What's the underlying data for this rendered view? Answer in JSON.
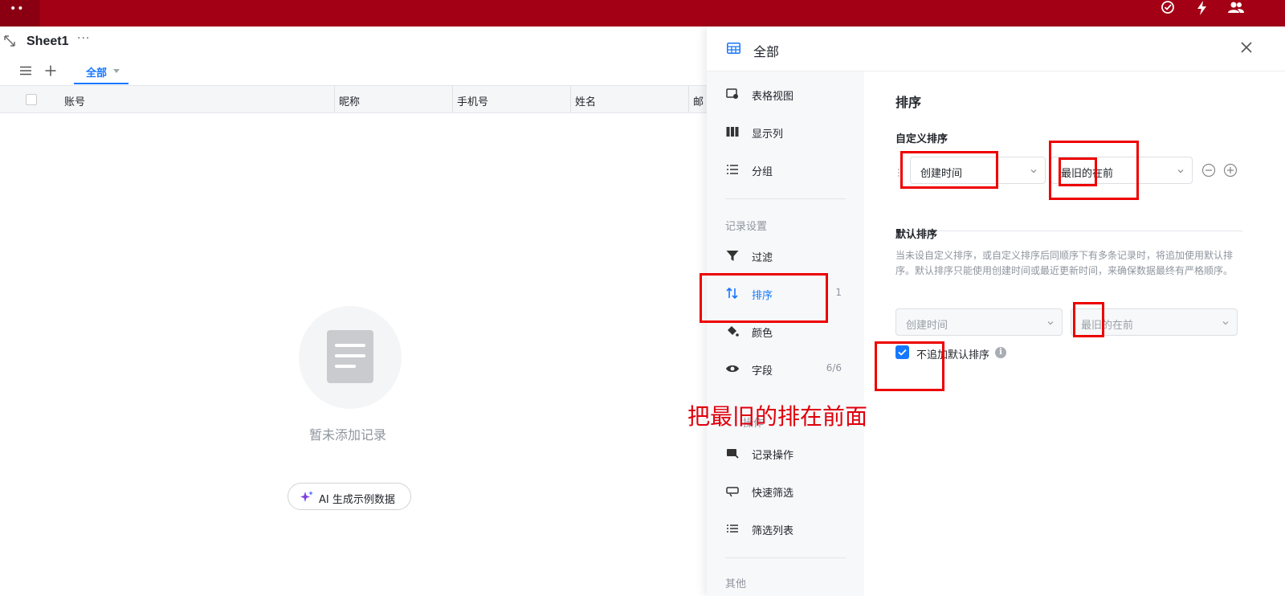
{
  "topbar": {
    "logo": "••",
    "icons": [
      "check-circle-icon",
      "lightning-icon",
      "users-icon"
    ]
  },
  "sheet": {
    "name": "Sheet1",
    "more": "···"
  },
  "toolbar": {
    "view_tab": "全部"
  },
  "table": {
    "columns": [
      "账号",
      "昵称",
      "手机号",
      "姓名",
      "邮"
    ]
  },
  "empty": {
    "text": "暂未添加记录",
    "ai_button": "AI 生成示例数据"
  },
  "panel": {
    "title": "全部",
    "nav": {
      "items_top": [
        {
          "label": "表格视图",
          "icon": "table-view-icon"
        },
        {
          "label": "显示列",
          "icon": "columns-icon"
        },
        {
          "label": "分组",
          "icon": "group-icon"
        }
      ],
      "group_record": "记录设置",
      "items_record": [
        {
          "label": "过滤",
          "icon": "filter-icon",
          "count": ""
        },
        {
          "label": "排序",
          "icon": "sort-icon",
          "count": "1"
        },
        {
          "label": "颜色",
          "icon": "paint-bucket-icon",
          "count": ""
        },
        {
          "label": "字段",
          "icon": "eye-icon",
          "count": "6/6"
        }
      ],
      "group_ops": "操作",
      "items_ops": [
        {
          "label": "记录操作",
          "icon": "record-action-icon"
        },
        {
          "label": "快速筛选",
          "icon": "quick-filter-icon"
        },
        {
          "label": "筛选列表",
          "icon": "filter-list-icon"
        }
      ],
      "group_other": "其他"
    },
    "sort": {
      "heading": "排序",
      "custom_heading": "自定义排序",
      "custom_field": "创建时间",
      "custom_order": "最旧的在前",
      "default_heading": "默认排序",
      "default_desc": "当未设自定义排序，或自定义排序后同顺序下有多条记录时，将追加使用默认排序。默认排序只能使用创建时间或最近更新时间，来确保数据最终有严格顺序。",
      "default_field": "创建时间",
      "default_order": "最旧的在前",
      "no_append_label": "不追加默认排序",
      "no_append_checked": true
    }
  },
  "annotation": {
    "text": "把最旧的排在前面"
  },
  "colors": {
    "topbar": "#a30016",
    "accent": "#1677ff",
    "annotation": "#e0000c"
  }
}
